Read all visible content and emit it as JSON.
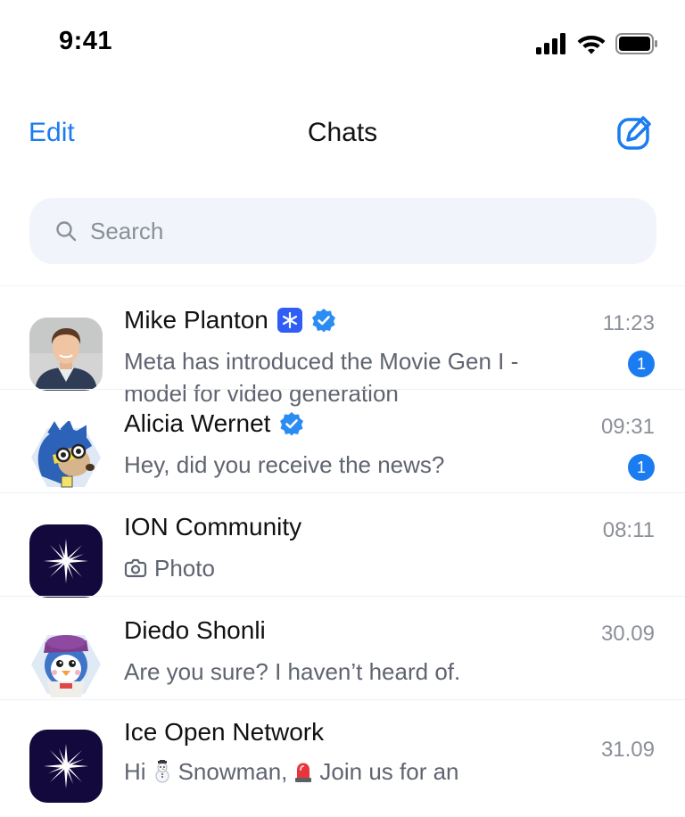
{
  "status_bar": {
    "time": "9:41"
  },
  "nav": {
    "edit_label": "Edit",
    "title": "Chats"
  },
  "search": {
    "placeholder": "Search"
  },
  "chats": [
    {
      "name": "Mike Planton",
      "message": "Meta has introduced the Movie Gen I - model for video generation",
      "time": "11:23",
      "unread": "1",
      "avatar": "portrait-photo",
      "verified": true,
      "ion_badge": true
    },
    {
      "name": "Alicia Wernet",
      "message": "Hey, did you receive the news?",
      "time": "09:31",
      "unread": "1",
      "avatar": "hedgehog-cartoon",
      "verified": true
    },
    {
      "name": "ION Community",
      "message": "Photo",
      "time": "08:11",
      "avatar": "ion-star-logo",
      "message_icon": "camera-icon"
    },
    {
      "name": "Diedo Shonli",
      "message": "Are you sure? I haven’t heard of.",
      "time": "30.09",
      "avatar": "penguin-cartoon"
    },
    {
      "name": "Ice Open Network",
      "message_parts": [
        "Hi",
        "Snowman,",
        "Join us for an"
      ],
      "time": "31.09",
      "avatar": "ion-star-logo",
      "message_icons": [
        "snowman-emoji",
        "siren-emoji"
      ]
    }
  ],
  "colors": {
    "accent": "#1a7cf0",
    "verified": "#2b8cf3",
    "ion_badge": "#2f5df5",
    "logo_bg": "#14093c"
  }
}
